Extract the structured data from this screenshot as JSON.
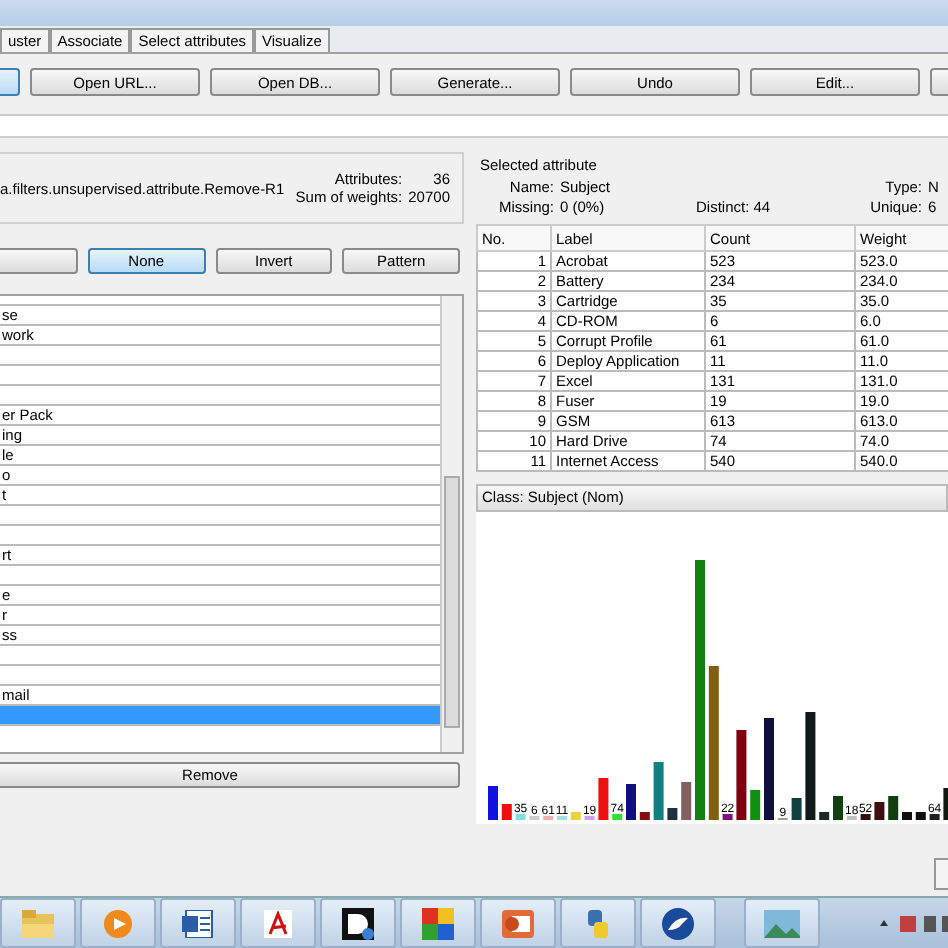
{
  "tabs": [
    {
      "label": "uster",
      "selected": false
    },
    {
      "label": "Associate",
      "selected": false
    },
    {
      "label": "Select attributes",
      "selected": false
    },
    {
      "label": "Visualize",
      "selected": false
    }
  ],
  "toolbar": [
    {
      "selected": true
    },
    {
      "label": "Open URL...",
      "selected": false
    },
    {
      "label": "Open DB...",
      "selected": false
    },
    {
      "label": "Generate...",
      "selected": false
    },
    {
      "label": "Undo",
      "selected": false
    },
    {
      "label": "Edit...",
      "selected": false
    },
    {
      "selected": false
    }
  ],
  "relation": {
    "filter": "a.filters.unsupervised.attribute.Remove-R1",
    "attributes_label": "Attributes:",
    "attributes": "36",
    "weights_label": "Sum of weights:",
    "weights": "20700"
  },
  "attr_buttons": [
    {
      "selected": false
    },
    {
      "label": "None",
      "selected": true
    },
    {
      "label": "Invert",
      "selected": false
    },
    {
      "label": "Pattern",
      "selected": false
    }
  ],
  "attr_list": [
    {
      "text": "se",
      "selected": false
    },
    {
      "text": "work",
      "selected": false
    },
    {
      "selected": false
    },
    {
      "selected": false
    },
    {
      "selected": false
    },
    {
      "text": "er Pack",
      "selected": false
    },
    {
      "text": "ing",
      "selected": false
    },
    {
      "text": "le",
      "selected": false
    },
    {
      "text": "o",
      "selected": false
    },
    {
      "text": "t",
      "selected": false
    },
    {
      "selected": false
    },
    {
      "selected": false
    },
    {
      "text": "rt",
      "selected": false
    },
    {
      "selected": false
    },
    {
      "text": "e",
      "selected": false
    },
    {
      "text": "r",
      "selected": false
    },
    {
      "text": "ss",
      "selected": false
    },
    {
      "selected": false
    },
    {
      "selected": false
    },
    {
      "text": "mail",
      "selected": false
    },
    {
      "selected": true
    }
  ],
  "remove_button": "Remove",
  "selected_attribute": {
    "title": "Selected attribute",
    "name_label": "Name:",
    "name": "Subject",
    "type_label": "Type:",
    "type": "N",
    "missing_label": "Missing:",
    "missing": "0 (0%)",
    "distinct_label": "Distinct:",
    "distinct": "44",
    "unique_label": "Unique:",
    "unique": "6"
  },
  "table": {
    "columns": [
      "No.",
      "Label",
      "Count",
      "Weight"
    ],
    "rows": [
      [
        "1",
        "Acrobat",
        "523",
        "523.0"
      ],
      [
        "2",
        "Battery",
        "234",
        "234.0"
      ],
      [
        "3",
        "Cartridge",
        "35",
        "35.0"
      ],
      [
        "4",
        "CD-ROM",
        "6",
        "6.0"
      ],
      [
        "5",
        "Corrupt Profile",
        "61",
        "61.0"
      ],
      [
        "6",
        "Deploy Application",
        "11",
        "11.0"
      ],
      [
        "7",
        "Excel",
        "131",
        "131.0"
      ],
      [
        "8",
        "Fuser",
        "19",
        "19.0"
      ],
      [
        "9",
        "GSM",
        "613",
        "613.0"
      ],
      [
        "10",
        "Hard Drive",
        "74",
        "74.0"
      ],
      [
        "11",
        "Internet Access",
        "540",
        "540.0"
      ]
    ]
  },
  "class_selector": "Class:  Subject (Nom)",
  "histogram": {
    "bars": [
      {
        "color": "#1010e0"
      },
      {
        "color": "#ee1010"
      },
      {
        "color": "#80e0e0",
        "label": "35"
      },
      {
        "color": "#cccccc",
        "label": "6"
      },
      {
        "color": "#f0b0b0",
        "label": "61"
      },
      {
        "color": "#a0e0e0",
        "label": "11"
      },
      {
        "color": "#f0d040"
      },
      {
        "color": "#d0a0f0",
        "label": "19"
      },
      {
        "color": "#ee1010"
      },
      {
        "color": "#30e030",
        "label": "74"
      },
      {
        "color": "#101080"
      },
      {
        "color": "#801010"
      },
      {
        "color": "#108080"
      },
      {
        "color": "#203040"
      },
      {
        "color": "#806060"
      },
      {
        "color": "#108010"
      },
      {
        "color": "#806010"
      },
      {
        "color": "#801080",
        "label": "22"
      },
      {
        "color": "#800010"
      },
      {
        "color": "#109010"
      },
      {
        "color": "#101040"
      },
      {
        "color": "#a0a0a0",
        "label": "9"
      },
      {
        "color": "#104040"
      },
      {
        "color": "#101818"
      },
      {
        "color": "#202828"
      },
      {
        "color": "#104010"
      },
      {
        "color": "#c0c0c0",
        "label": "18"
      },
      {
        "color": "#301010",
        "label": "52"
      },
      {
        "color": "#401010"
      },
      {
        "color": "#104010"
      },
      {
        "color": "#101010"
      },
      {
        "color": "#101010"
      },
      {
        "color": "#202020",
        "label": "64"
      },
      {
        "color": "#101810"
      }
    ]
  },
  "taskbar": [
    {
      "kind": "folder",
      "selected": false
    },
    {
      "kind": "player",
      "selected": false
    },
    {
      "kind": "word",
      "selected": false
    },
    {
      "kind": "pdf",
      "selected": false
    },
    {
      "kind": "d",
      "selected": false
    },
    {
      "kind": "tiles",
      "selected": false
    },
    {
      "kind": "slides",
      "selected": false
    },
    {
      "kind": "python",
      "selected": false
    },
    {
      "kind": "bird",
      "selected": false
    },
    {
      "kind": "photo",
      "selected": false
    }
  ]
}
